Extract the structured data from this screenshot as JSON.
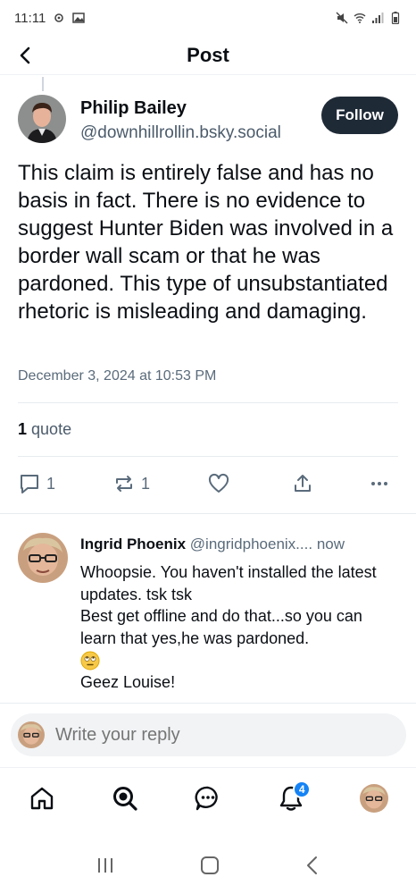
{
  "status_bar": {
    "time": "11:11"
  },
  "header": {
    "title": "Post"
  },
  "post": {
    "author_name": "Philip Bailey",
    "author_handle": "@downhillrollin.bsky.social",
    "follow_label": "Follow",
    "text": "This claim is entirely false and has no basis in fact. There is no evidence to suggest Hunter Biden was involved in a border wall scam or that he was pardoned. This type of unsubstantiated rhetoric is misleading and damaging.",
    "timestamp": "December 3, 2024 at 10:53 PM",
    "quote_count": "1",
    "quote_label": "quote",
    "reply_count": "1",
    "repost_count": "1"
  },
  "reply": {
    "author_name": "Ingrid Phoenix",
    "author_handle": "@ingridphoenix....",
    "time": "now",
    "line1": "Whoopsie. You haven't installed the latest updates. tsk tsk",
    "line2": "Best get offline and do that...so you can learn that yes,he was pardoned.",
    "line3": "Geez Louise!"
  },
  "compose": {
    "placeholder": "Write your reply"
  },
  "nav": {
    "notifications_badge": "4"
  },
  "colors": {
    "follow_bg": "#1f2a37",
    "badge": "#1583f5",
    "muted": "#5a6b7b"
  }
}
